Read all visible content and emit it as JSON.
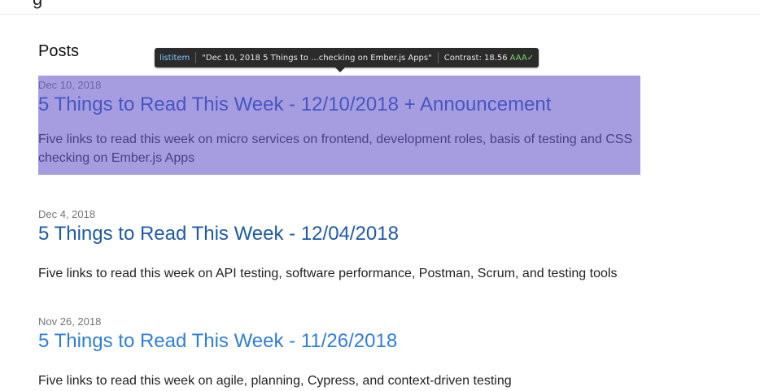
{
  "header": {
    "brand_fragment": "g"
  },
  "main": {
    "section_title": "Posts",
    "posts": [
      {
        "date": "Dec 10, 2018",
        "title": "5 Things to Read This Week - 12/10/2018 + Announcement",
        "excerpt": "Five links to read this week on micro services on frontend, development roles, basis of testing and CSS checking on Ember.js Apps"
      },
      {
        "date": "Dec 4, 2018",
        "title": "5 Things to Read This Week - 12/04/2018",
        "excerpt": "Five links to read this week on API testing, software performance, Postman, Scrum, and testing tools"
      },
      {
        "date": "Nov 26, 2018",
        "title": "5 Things to Read This Week - 11/26/2018",
        "excerpt": "Five links to read this week on agile, planning, Cypress, and context-driven testing"
      }
    ]
  },
  "inspector_tooltip": {
    "role": "listitem",
    "name": "\"Dec 10, 2018 5 Things to ...checking on Ember.js Apps\"",
    "contrast_label": "Contrast: 18.56",
    "rating": "AAA",
    "check": "✓",
    "highlight_color": "#6656cc"
  }
}
